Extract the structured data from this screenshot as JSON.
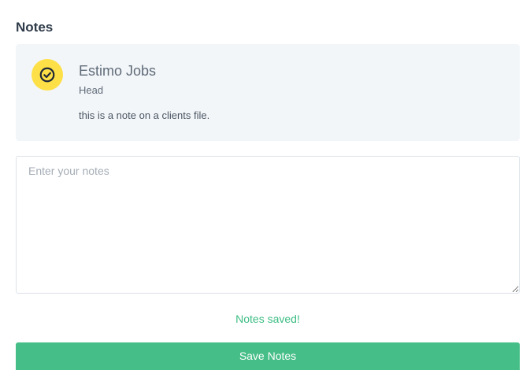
{
  "section": {
    "title": "Notes"
  },
  "note": {
    "avatar_icon": "check-circle-icon",
    "avatar_color": "#fde047",
    "author": "Estimo Jobs",
    "role": "Head",
    "body": "this is a note on a clients file."
  },
  "editor": {
    "placeholder": "Enter your notes",
    "value": ""
  },
  "status": {
    "message": "Notes saved!",
    "color": "#3dbd84"
  },
  "actions": {
    "save_label": "Save Notes",
    "save_color": "#45be87"
  }
}
